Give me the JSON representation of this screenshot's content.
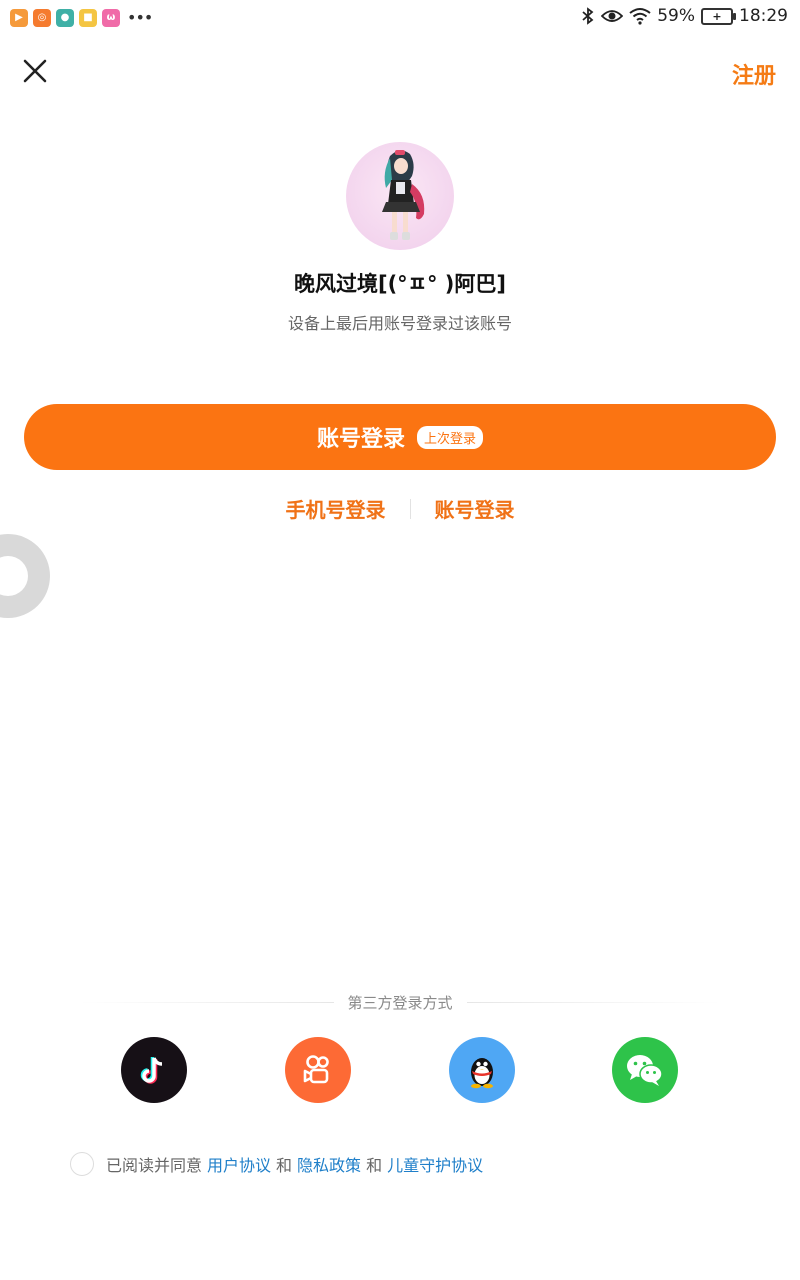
{
  "status_bar": {
    "app_icons": [
      {
        "name": "video-app-icon",
        "color": "#f59a3b",
        "glyph": "▶"
      },
      {
        "name": "kuaishou-app-icon",
        "color": "#f57b2f",
        "glyph": "◎"
      },
      {
        "name": "panda-app-icon",
        "color": "#3fb0a6",
        "glyph": "●"
      },
      {
        "name": "yellow-app-icon",
        "color": "#f4c542",
        "glyph": "■"
      },
      {
        "name": "pink-app-icon",
        "color": "#f06ba8",
        "glyph": "ω"
      }
    ],
    "more": "•••",
    "battery_percent": "59%",
    "time": "18:29"
  },
  "header": {
    "register_label": "注册"
  },
  "profile": {
    "username": "晚风过境[(°ㅍ° )阿巴]",
    "subtitle": "设备上最后用账号登录过该账号"
  },
  "main_button": {
    "label": "账号登录",
    "badge": "上次登录",
    "color": "#fb7412"
  },
  "alt_login": {
    "phone_label": "手机号登录",
    "account_label": "账号登录"
  },
  "third_party": {
    "title": "第三方登录方式",
    "providers": [
      {
        "name": "douyin",
        "icon": "douyin-icon",
        "color": "#161016"
      },
      {
        "name": "kuaishou",
        "icon": "kuaishou-icon",
        "color": "#fd6a35"
      },
      {
        "name": "qq",
        "icon": "qq-penguin-icon",
        "color": "#4fa7f4"
      },
      {
        "name": "wechat",
        "icon": "wechat-icon",
        "color": "#2ec34a"
      }
    ]
  },
  "agreement": {
    "prefix": "已阅读并同意",
    "user_agreement": "用户协议",
    "and1": "和",
    "privacy_policy": "隐私政策",
    "and2": "和",
    "child_protection": "儿童守护协议"
  }
}
